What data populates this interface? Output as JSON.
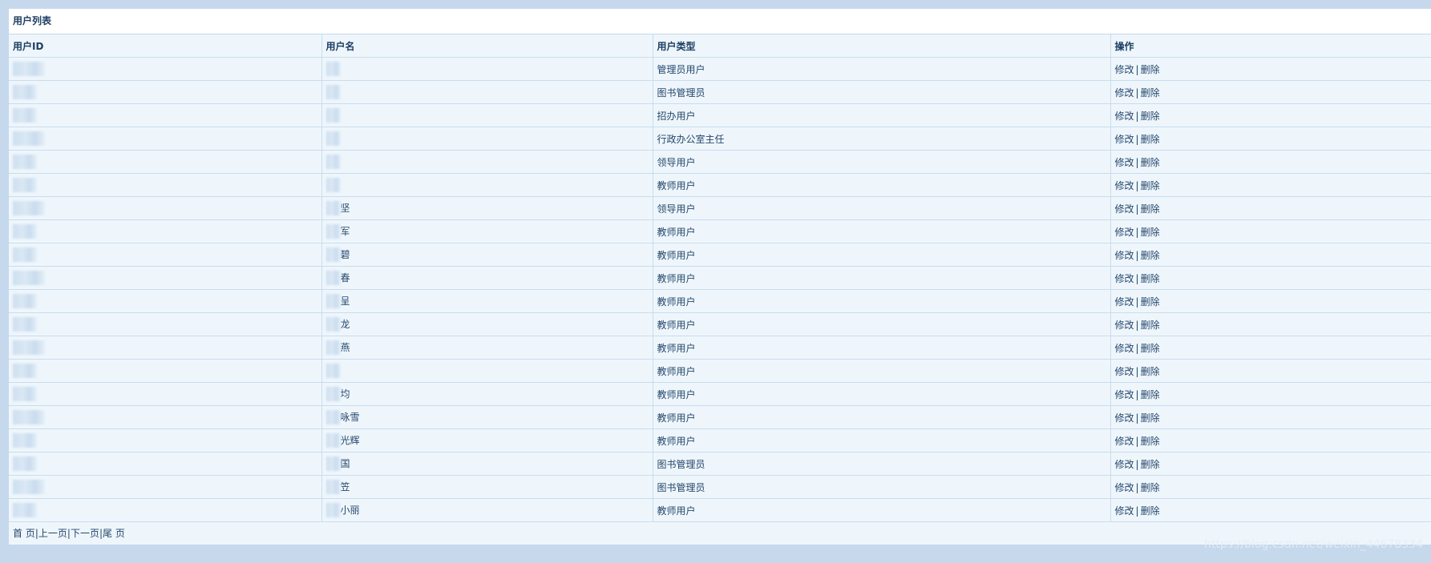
{
  "panel": {
    "title": "用户列表"
  },
  "table": {
    "headers": [
      "用户ID",
      "用户名",
      "用户类型",
      "操作"
    ],
    "rows": [
      {
        "id": "",
        "name": "",
        "type": "管理员用户"
      },
      {
        "id": "",
        "name": "",
        "type": "图书管理员"
      },
      {
        "id": "",
        "name": "",
        "type": "招办用户"
      },
      {
        "id": "",
        "name": "",
        "type": "行政办公室主任"
      },
      {
        "id": "",
        "name": "",
        "type": "领导用户"
      },
      {
        "id": "",
        "name": "",
        "type": "教师用户"
      },
      {
        "id": "",
        "name": "坚",
        "type": "领导用户"
      },
      {
        "id": "",
        "name": "军",
        "type": "教师用户"
      },
      {
        "id": "",
        "name": "碧",
        "type": "教师用户"
      },
      {
        "id": "",
        "name": "春",
        "type": "教师用户"
      },
      {
        "id": "",
        "name": "呈",
        "type": "教师用户"
      },
      {
        "id": "",
        "name": "龙",
        "type": "教师用户"
      },
      {
        "id": "",
        "name": "燕",
        "type": "教师用户"
      },
      {
        "id": "",
        "name": "",
        "type": "教师用户"
      },
      {
        "id": "",
        "name": "均",
        "type": "教师用户"
      },
      {
        "id": "",
        "name": "咏雪",
        "type": "教师用户"
      },
      {
        "id": "",
        "name": "光辉",
        "type": "教师用户"
      },
      {
        "id": "",
        "name": "国",
        "type": "图书管理员"
      },
      {
        "id": "",
        "name": "笠",
        "type": "图书管理员"
      },
      {
        "id": "",
        "name": "小丽",
        "type": "教师用户"
      }
    ],
    "edit_label": "修改",
    "separator": "|",
    "delete_label": "删除"
  },
  "pager": {
    "first": "首 页",
    "prev": "上一页",
    "next": "下一页",
    "last": "尾 页",
    "separator": "|"
  },
  "watermark": "https://blog.csdn.net/weixin_44678334"
}
